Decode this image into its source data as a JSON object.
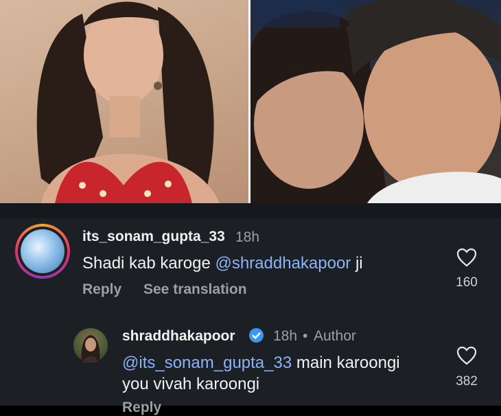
{
  "comments": [
    {
      "username": "its_sonam_gupta_33",
      "time": "18h",
      "text": "Shadi kab karoge",
      "mention": "@shraddhakapoor",
      "text_after": "ji",
      "reply_label": "Reply",
      "translate_label": "See translation",
      "like_count": "160",
      "like_icon": "heart-outline-icon"
    },
    {
      "username": "shraddhakapoor",
      "verified": true,
      "time": "18h",
      "separator": "•",
      "role": "Author",
      "mention": "@its_sonam_gupta_33",
      "text_line1": "main karoongi",
      "text_line2": "you vivah karoongi",
      "reply_label": "Reply",
      "like_count": "382",
      "like_icon": "heart-outline-icon"
    }
  ],
  "colors": {
    "background": "#1c1f24",
    "mention": "#8ab4f8",
    "muted": "#9aa0a6",
    "verified": "#3897f0"
  }
}
